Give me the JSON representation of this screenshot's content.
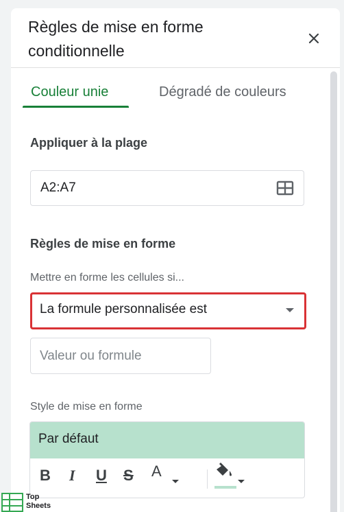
{
  "panel": {
    "title": "Règles de mise en forme conditionnelle",
    "close_icon": "close-icon"
  },
  "tabs": [
    {
      "label": "Couleur unie",
      "active": true
    },
    {
      "label": "Dégradé de couleurs",
      "active": false
    }
  ],
  "apply_range": {
    "title": "Appliquer à la plage",
    "value": "A2:A7",
    "icon": "grid-select-icon"
  },
  "format_rules": {
    "title": "Règles de mise en forme",
    "condition_label": "Mettre en forme les cellules si...",
    "condition_value": "La formule personnalisée est",
    "value_placeholder": "Valeur ou formule",
    "value": ""
  },
  "formatting_style": {
    "label": "Style de mise en forme",
    "preset": "Par défaut",
    "preview_color": "#b7e1cd",
    "toolbar": {
      "bold": "B",
      "italic": "I",
      "underline": "U",
      "strikethrough": "S",
      "text_color": "A",
      "fill_icon": "fill-color-icon"
    }
  },
  "logo": {
    "line1": "Top",
    "line2": "Sheets"
  },
  "colors": {
    "accent_green": "#188038",
    "highlight_red": "#d93235",
    "preview_green": "#b7e1cd"
  }
}
